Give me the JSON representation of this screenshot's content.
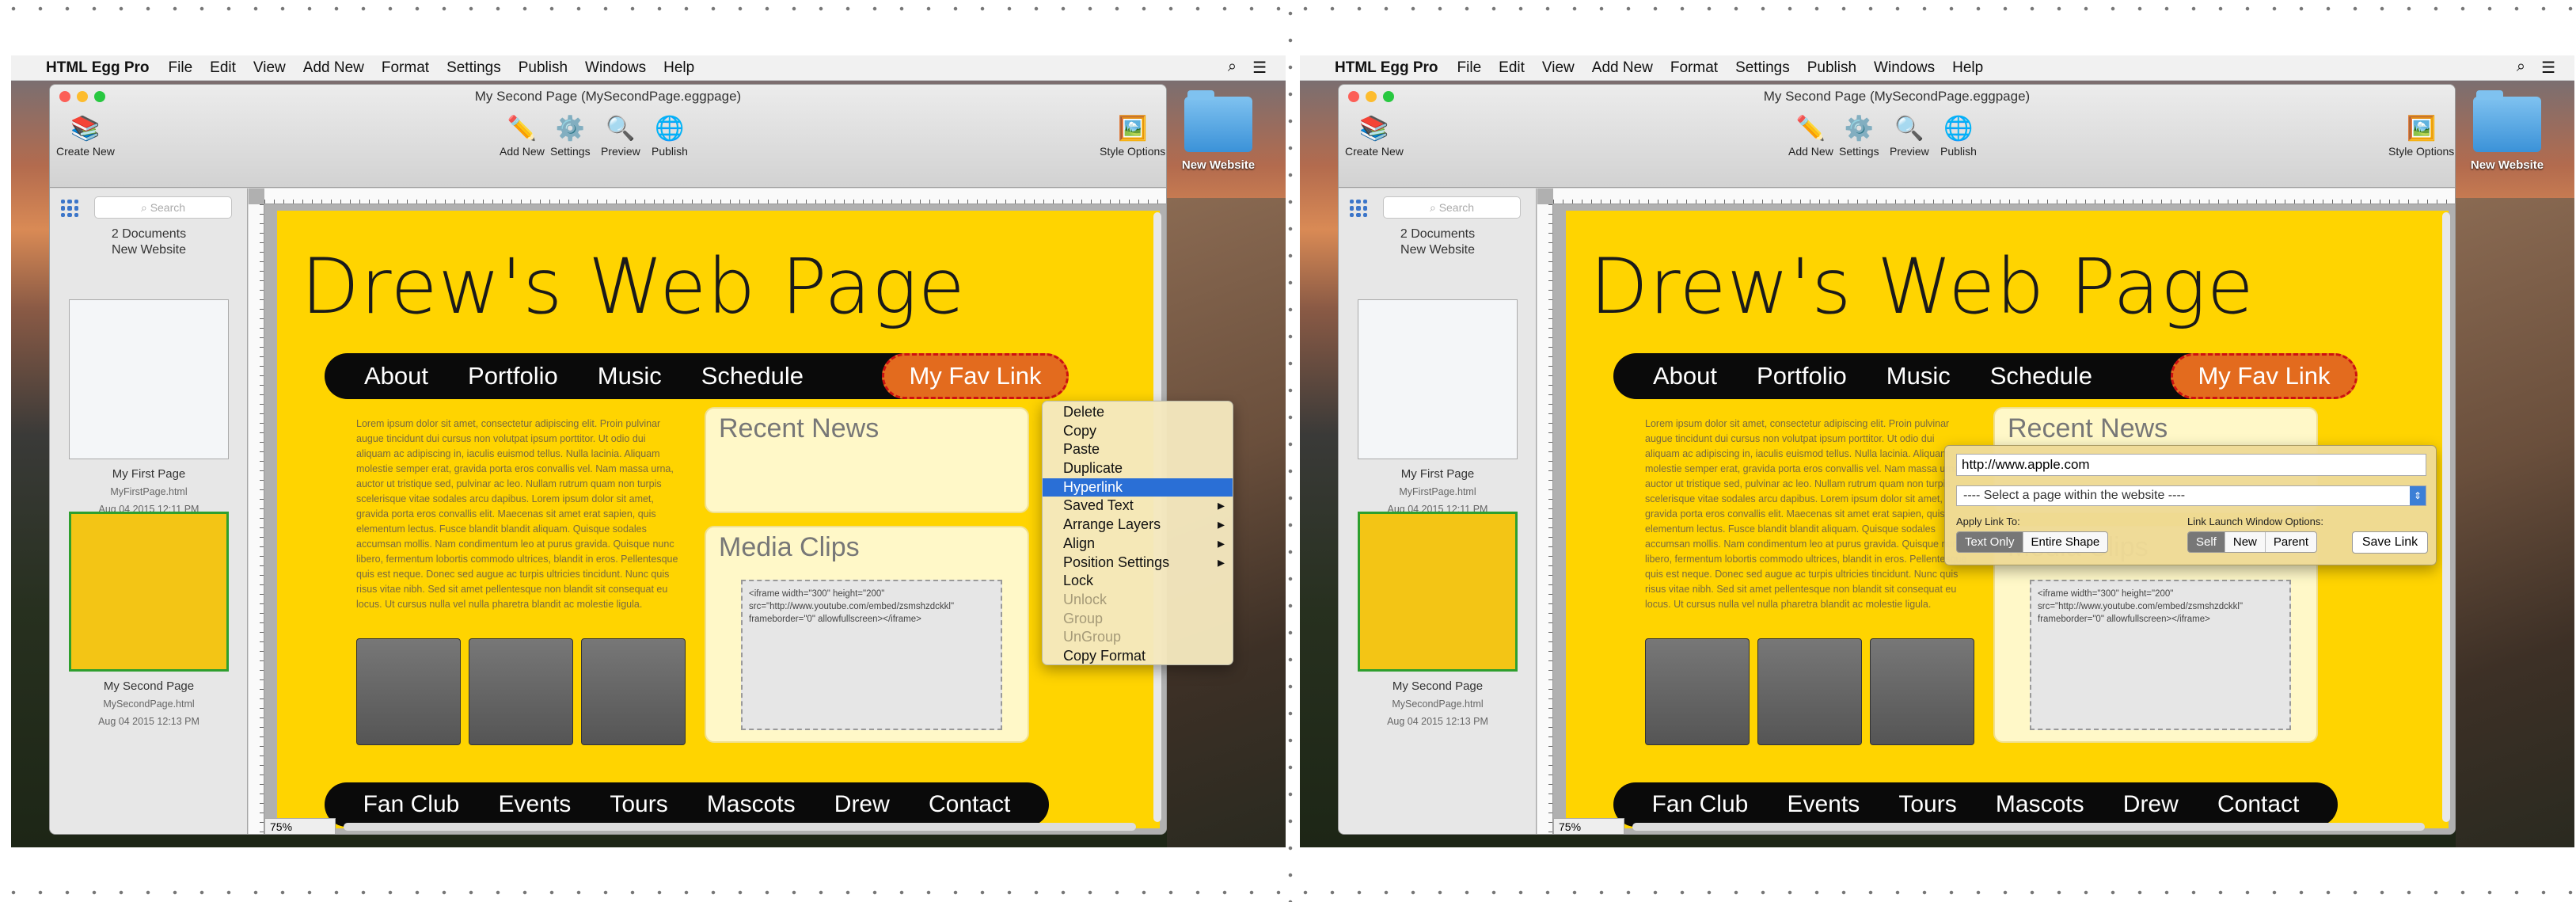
{
  "menubar": {
    "apple": "",
    "app_name": "HTML Egg Pro",
    "items": [
      "File",
      "Edit",
      "View",
      "Add New",
      "Format",
      "Settings",
      "Publish",
      "Windows",
      "Help"
    ]
  },
  "window": {
    "title": "My Second Page (MySecondPage.eggpage)",
    "toolbar": {
      "create_new": "Create New",
      "add_new": "Add New",
      "settings": "Settings",
      "preview": "Preview",
      "publish": "Publish",
      "style_options": "Style Options"
    }
  },
  "sidebar": {
    "search_placeholder": "Search",
    "doc_count": "2 Documents",
    "site_name": "New Website",
    "pages": [
      {
        "name": "My First Page",
        "file": "MyFirstPage.html",
        "date": "Aug 04 2015 12:11 PM"
      },
      {
        "name": "My Second Page",
        "file": "MySecondPage.html",
        "date": "Aug 04 2015 12:13 PM"
      }
    ]
  },
  "desktop": {
    "folder_label": "New Website"
  },
  "page": {
    "title": "Drew's Web Page",
    "nav": [
      "About",
      "Portfolio",
      "Music",
      "Schedule"
    ],
    "fav_link": "My Fav Link",
    "lorem": "Lorem ipsum dolor sit amet, consectetur adipiscing elit. Proin pulvinar augue tincidunt dui cursus non volutpat ipsum porttitor. Ut odio dui aliquam ac adipiscing in, iaculis euismod tellus. Nulla lacinia. Aliquam molestie semper erat, gravida porta eros convallis vel. Nam massa urna, auctor ut tristique sed, pulvinar ac leo. Nullam rutrum quam non turpis scelerisque vitae sodales arcu dapibus. Lorem ipsum dolor sit amet, gravida porta eros convallis elit. Maecenas sit amet erat sapien, quis elementum lectus. Fusce blandit blandit aliquam. Quisque sodales accumsan mollis. Nam condimentum leo at purus gravida. Quisque nunc libero, fermentum lobortis commodo ultrices, blandit in eros. Pellentesque quis est neque. Donec sed augue ac turpis ultricies tincidunt. Nunc quis risus vitae nibh. Sed sit amet pellentesque non blandit sit consequat eu locus. Ut cursus nulla vel nulla pharetra blandit ac molestie ligula.",
    "recent_news": "Recent News",
    "media_clips": "Media Clips",
    "embed_code": "<iframe width=\"300\" height=\"200\" src=\"http://www.youtube.com/embed/zsmshzdckkl\" frameborder=\"0\" allowfullscreen></iframe>",
    "footer_nav": [
      "Fan Club",
      "Events",
      "Tours",
      "Mascots",
      "Drew",
      "Contact"
    ],
    "zoom": "75%"
  },
  "context_menu": {
    "items": [
      {
        "label": "Delete"
      },
      {
        "label": "Copy"
      },
      {
        "label": "Paste"
      },
      {
        "label": "Duplicate"
      },
      {
        "label": "Hyperlink",
        "highlighted": true
      },
      {
        "label": "Saved Text",
        "submenu": true
      },
      {
        "label": "Arrange Layers",
        "submenu": true
      },
      {
        "label": "Align",
        "submenu": true
      },
      {
        "label": "Position Settings",
        "submenu": true
      },
      {
        "label": "Lock"
      },
      {
        "label": "Unlock",
        "disabled": true
      },
      {
        "label": "Group",
        "disabled": true
      },
      {
        "label": "UnGroup",
        "disabled": true
      },
      {
        "label": "Copy Format"
      }
    ]
  },
  "link_popup": {
    "url": "http://www.apple.com",
    "page_select": "---- Select a page within the website ----",
    "apply_label": "Apply Link To:",
    "apply_options": [
      "Text Only",
      "Entire Shape"
    ],
    "launch_label": "Link Launch Window Options:",
    "launch_options": [
      "Self",
      "New",
      "Parent"
    ],
    "save": "Save Link"
  },
  "colors": {
    "page_bg": "#ffd400",
    "nav_bg": "#0a0a0a",
    "fav_link": "#e36b1e",
    "highlight": "#2a6fd6"
  }
}
